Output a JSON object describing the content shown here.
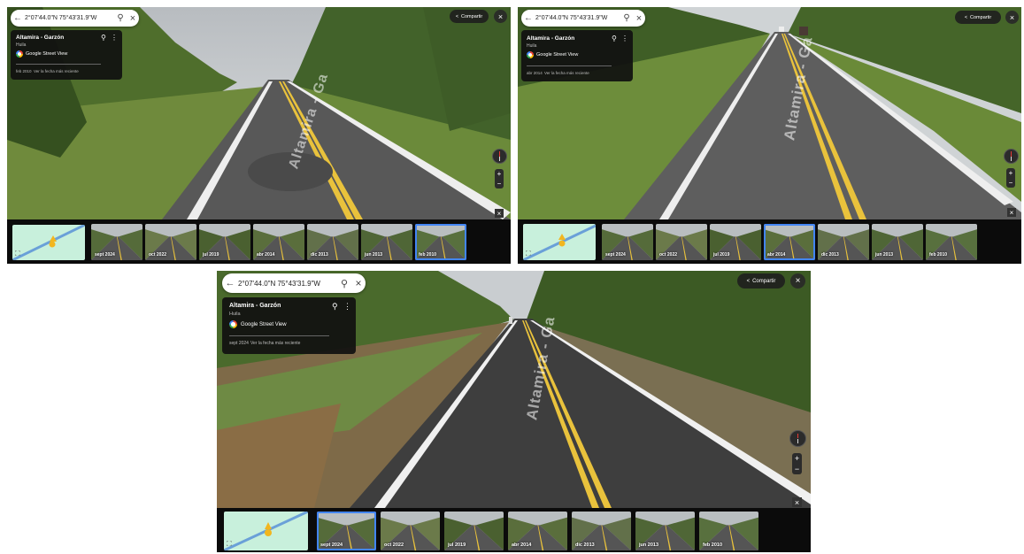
{
  "panels": [
    {
      "id": "panel-1",
      "search": {
        "coords": "2°07'44.0\"N 75°43'31.9\"W"
      },
      "card": {
        "title": "Altamira - Garzón",
        "subtitle": "Huila",
        "source": "Google Street View",
        "capture_date": "feb 2010",
        "newest_link": "Ver la fecha más reciente"
      },
      "share_label": "Compartir",
      "road_label": "Altamira - Ga",
      "timeline": [
        "sept 2024",
        "oct 2022",
        "jul 2019",
        "abr 2014",
        "dic 2013",
        "jun 2013",
        "feb 2010"
      ],
      "selected_index": 6
    },
    {
      "id": "panel-2",
      "search": {
        "coords": "2°07'44.0\"N 75°43'31.9\"W"
      },
      "card": {
        "title": "Altamira - Garzón",
        "subtitle": "Huila",
        "source": "Google Street View",
        "capture_date": "abr 2014",
        "newest_link": "Ver la fecha más reciente"
      },
      "share_label": "Compartir",
      "road_label": "Altamira - Ga",
      "timeline": [
        "sept 2024",
        "oct 2022",
        "jul 2019",
        "abr 2014",
        "dic 2013",
        "jun 2013",
        "feb 2010"
      ],
      "selected_index": 3
    },
    {
      "id": "panel-3",
      "search": {
        "coords": "2°07'44.0\"N 75°43'31.9\"W"
      },
      "card": {
        "title": "Altamira - Garzón",
        "subtitle": "Huila",
        "source": "Google Street View",
        "capture_date": "sept 2024",
        "newest_link": "Ver la fecha más reciente"
      },
      "share_label": "Compartir",
      "road_label": "Altamira - Ga",
      "timeline": [
        "sept 2024",
        "oct 2022",
        "jul 2019",
        "abr 2014",
        "dic 2013",
        "jun 2013",
        "feb 2010"
      ],
      "selected_index": 0
    }
  ],
  "icons": {
    "back": "←",
    "search": "⚲",
    "close": "×",
    "pin": "⚲",
    "more": "⋮",
    "share": "<",
    "zoom_in": "+",
    "zoom_out": "−",
    "expand": "⛶"
  },
  "colors": {
    "selected_border": "#4285f4",
    "center_line": "#e9c23c",
    "minimap": "#c8f0dc"
  }
}
